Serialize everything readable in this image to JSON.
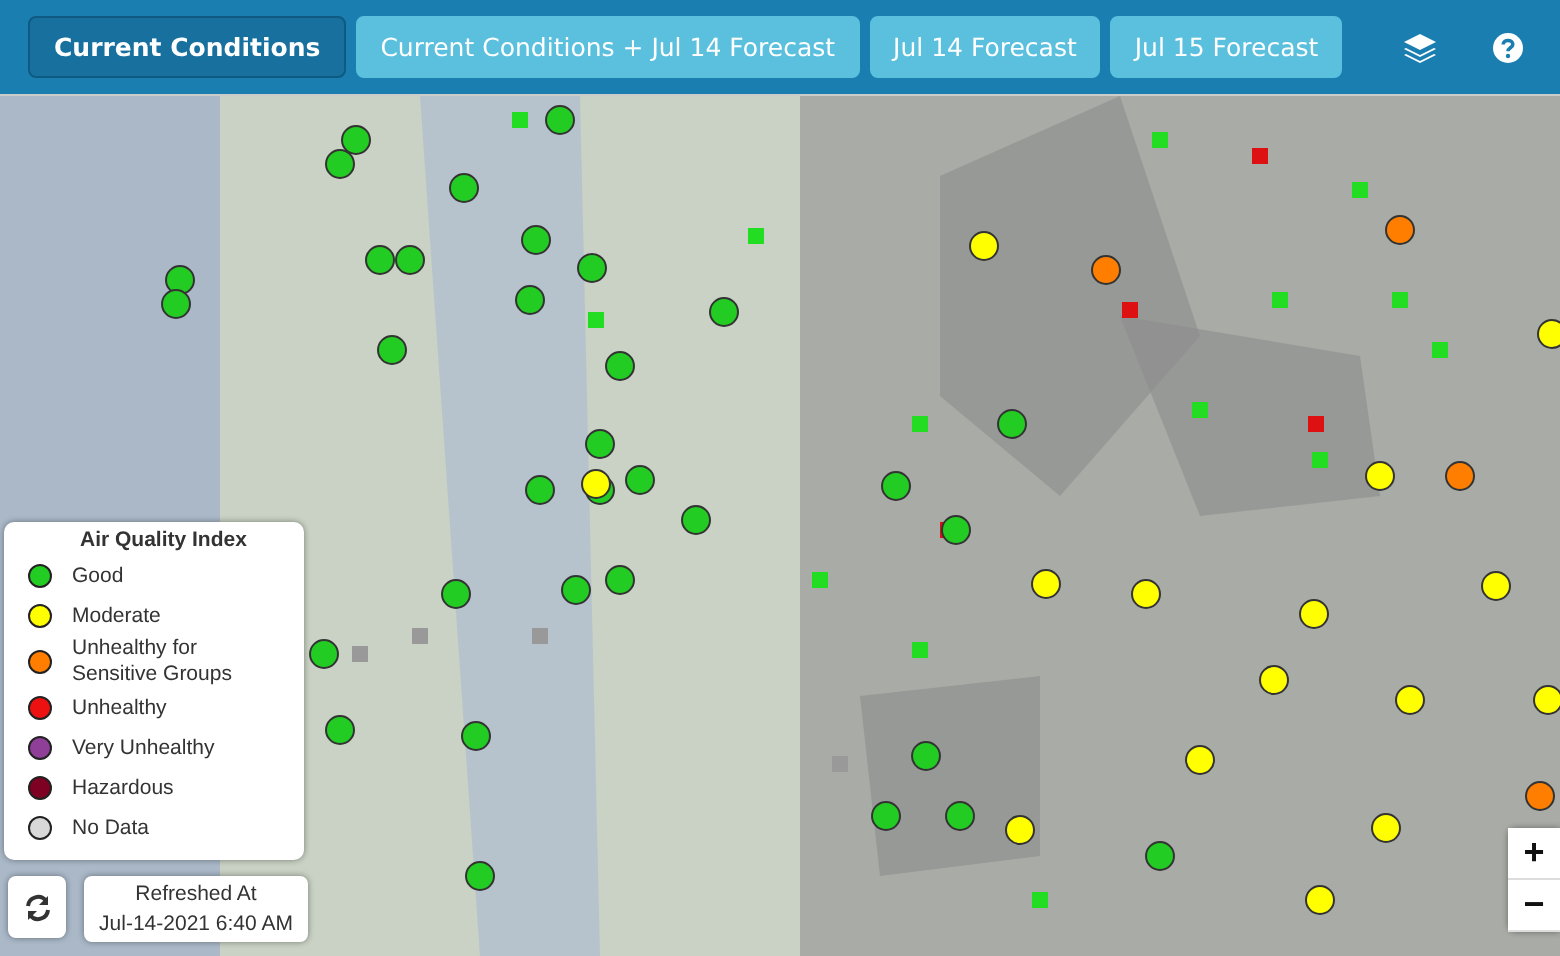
{
  "tabs": [
    {
      "label": "Current Conditions",
      "selected": true
    },
    {
      "label": "Current Conditions + Jul 14 Forecast",
      "selected": false
    },
    {
      "label": "Jul 14 Forecast",
      "selected": false
    },
    {
      "label": "Jul 15 Forecast",
      "selected": false
    }
  ],
  "legend": {
    "title": "Air Quality Index",
    "items": [
      {
        "label": "Good",
        "color": "#22cc22"
      },
      {
        "label": "Moderate",
        "color": "#ffff00"
      },
      {
        "label": "Unhealthy for Sensitive Groups",
        "color": "#ff7e00"
      },
      {
        "label": "Unhealthy",
        "color": "#ee1111"
      },
      {
        "label": "Very Unhealthy",
        "color": "#8f3f97"
      },
      {
        "label": "Hazardous",
        "color": "#7e0023"
      },
      {
        "label": "No Data",
        "color": "#d8d8d8"
      }
    ]
  },
  "refresh": {
    "label": "Refreshed At",
    "time": "Jul-14-2021 6:40 AM"
  },
  "zoom": {
    "in": "+",
    "out": "−"
  }
}
